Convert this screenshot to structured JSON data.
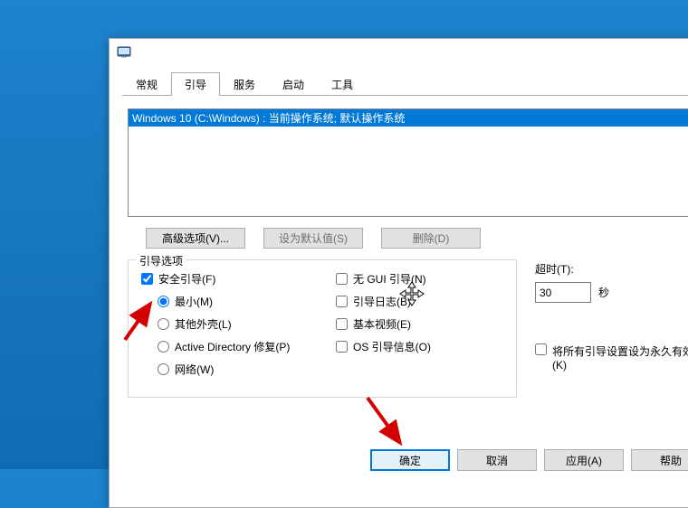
{
  "tabs": {
    "general": "常规",
    "boot": "引导",
    "services": "服务",
    "startup": "启动",
    "tools": "工具"
  },
  "bootlist": {
    "item0": "Windows 10 (C:\\Windows) : 当前操作系统; 默认操作系统"
  },
  "buttons": {
    "advanced": "高级选项(V)...",
    "setdefault": "设为默认值(S)",
    "delete": "删除(D)"
  },
  "group": {
    "legend": "引导选项",
    "safeboot": "安全引导(F)",
    "minimal": "最小(M)",
    "altshell": "其他外壳(L)",
    "adrepair": "Active Directory 修复(P)",
    "network": "网络(W)",
    "nogui": "无 GUI 引导(N)",
    "bootlog": "引导日志(B)",
    "basevideo": "基本视频(E)",
    "osbootinfo": "OS 引导信息(O)"
  },
  "timeout": {
    "label": "超时(T):",
    "value": "30",
    "unit": "秒"
  },
  "permanent": {
    "label1": "将所有引导设置设为永久有效",
    "label2": "(K)"
  },
  "footer": {
    "ok": "确定",
    "cancel": "取消",
    "apply": "应用(A)",
    "help": "帮助"
  }
}
